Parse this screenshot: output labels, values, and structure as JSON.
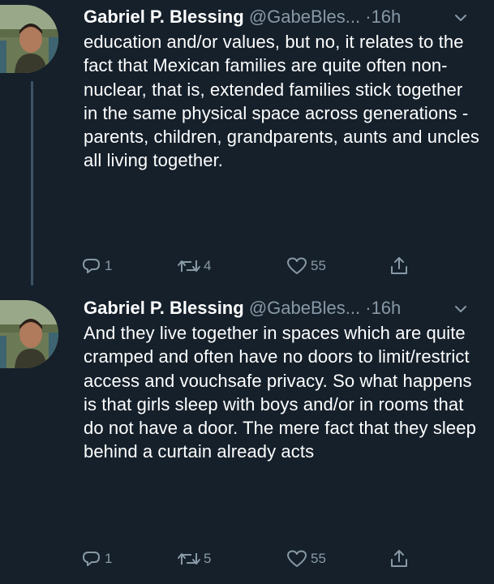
{
  "colors": {
    "background": "#15202b",
    "text_primary": "#ffffff",
    "text_secondary": "#8899a6",
    "thread_line": "#3d5466"
  },
  "tweets": [
    {
      "author_name": "Gabriel P. Blessing",
      "handle": "@GabeBles...",
      "separator": "·",
      "time": "16h",
      "text": "education and/or values, but no, it relates to the fact that Mexican families are quite often non-nuclear, that is, extended families stick together in the same physical space across generations - parents, children, grandparents, aunts and uncles all living together.",
      "replies": "1",
      "retweets": "4",
      "likes": "55",
      "icons": {
        "avatar": "avatar",
        "menu": "chevron-down-icon",
        "reply": "reply-icon",
        "retweet": "retweet-icon",
        "like": "heart-icon",
        "share": "share-icon"
      }
    },
    {
      "author_name": "Gabriel P. Blessing",
      "handle": "@GabeBles...",
      "separator": "·",
      "time": "16h",
      "text": "And they live together in spaces which are quite cramped and often have no doors to limit/restrict access and vouchsafe privacy. So what happens is that girls sleep with boys and/or in rooms that do not have a door. The mere fact that they sleep behind a curtain already acts",
      "replies": "1",
      "retweets": "5",
      "likes": "55",
      "icons": {
        "avatar": "avatar",
        "menu": "chevron-down-icon",
        "reply": "reply-icon",
        "retweet": "retweet-icon",
        "like": "heart-icon",
        "share": "share-icon"
      }
    }
  ]
}
